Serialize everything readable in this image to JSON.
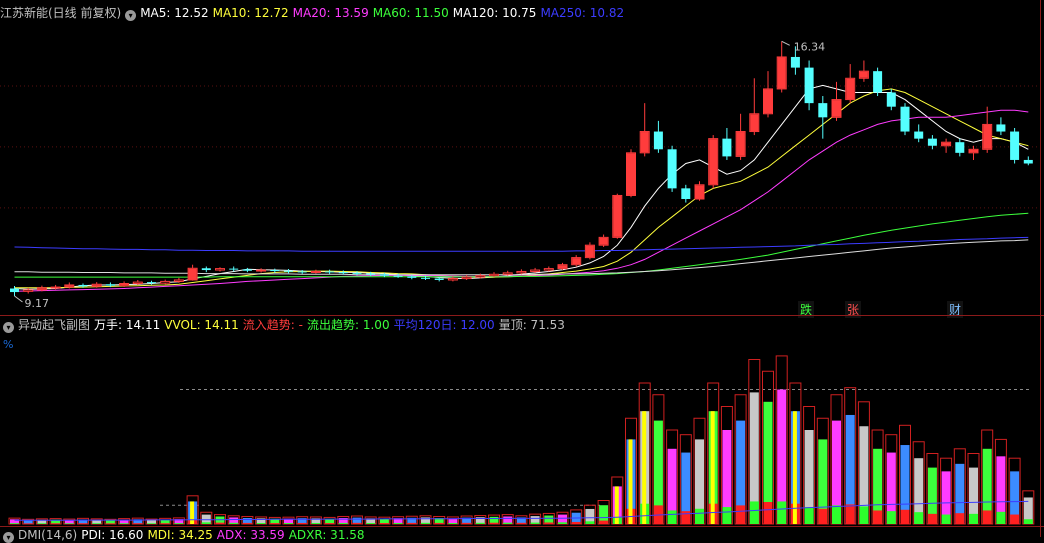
{
  "main_chart": {
    "title": "江苏新能(日线 前复权)",
    "ma": [
      {
        "label": "MA5: 12.52",
        "color": "#ffffff"
      },
      {
        "label": "MA10: 12.72",
        "color": "#ffff3c"
      },
      {
        "label": "MA20: 13.59",
        "color": "#ff3cff"
      },
      {
        "label": "MA60: 11.50",
        "color": "#3cff3c"
      },
      {
        "label": "MA120: 10.75",
        "color": "#ffffff"
      },
      {
        "label": "MA250: 10.82",
        "color": "#3c3cff"
      }
    ],
    "high_label": "16.34",
    "low_label": "9.17",
    "badges": [
      {
        "text": "跌",
        "color": "#3cff3c"
      },
      {
        "text": "张",
        "color": "#ff5050"
      },
      {
        "text": "财",
        "color": "#7fbfff"
      }
    ]
  },
  "indicator": {
    "title": "异动起飞副图",
    "items": [
      {
        "label": "万手: 14.11",
        "color": "#ffffff"
      },
      {
        "label": "VVOL: 14.11",
        "color": "#ffff3c"
      },
      {
        "label": "流入趋势: -",
        "color": "#ff3c3c"
      },
      {
        "label": "流出趋势: 1.00",
        "color": "#3cff3c"
      },
      {
        "label": "平均120日: 12.00",
        "color": "#3c3cff"
      },
      {
        "label": "量顶: 71.53",
        "color": "#c0c0c0"
      }
    ],
    "percent_label": "%"
  },
  "dmi": {
    "title": "DMI(14,6)",
    "items": [
      {
        "label": "PDI: 16.60",
        "color": "#ffffff"
      },
      {
        "label": "MDI: 34.25",
        "color": "#ffff3c"
      },
      {
        "label": "ADX: 33.59",
        "color": "#ff3cff"
      },
      {
        "label": "ADXR: 31.58",
        "color": "#3cff3c"
      }
    ]
  },
  "chart_data": {
    "type": "candlestick",
    "ylim": [
      9.0,
      16.8
    ],
    "candles": [
      [
        9.38,
        9.28,
        9.45,
        9.17
      ],
      [
        9.3,
        9.34,
        9.4,
        9.24
      ],
      [
        9.34,
        9.4,
        9.46,
        9.3
      ],
      [
        9.4,
        9.42,
        9.48,
        9.35
      ],
      [
        9.42,
        9.48,
        9.55,
        9.38
      ],
      [
        9.48,
        9.44,
        9.52,
        9.4
      ],
      [
        9.44,
        9.5,
        9.56,
        9.4
      ],
      [
        9.5,
        9.46,
        9.55,
        9.42
      ],
      [
        9.46,
        9.52,
        9.58,
        9.42
      ],
      [
        9.52,
        9.56,
        9.62,
        9.48
      ],
      [
        9.56,
        9.53,
        9.6,
        9.49
      ],
      [
        9.53,
        9.58,
        9.63,
        9.5
      ],
      [
        9.58,
        9.62,
        9.68,
        9.54
      ],
      [
        9.62,
        9.95,
        10.05,
        9.6
      ],
      [
        9.95,
        9.9,
        10.0,
        9.84
      ],
      [
        9.9,
        9.94,
        9.98,
        9.86
      ],
      [
        9.94,
        9.92,
        10.0,
        9.86
      ],
      [
        9.92,
        9.88,
        9.96,
        9.84
      ],
      [
        9.88,
        9.9,
        9.95,
        9.83
      ],
      [
        9.9,
        9.88,
        9.94,
        9.82
      ],
      [
        9.88,
        9.86,
        9.93,
        9.81
      ],
      [
        9.86,
        9.84,
        9.9,
        9.79
      ],
      [
        9.84,
        9.86,
        9.91,
        9.8
      ],
      [
        9.86,
        9.84,
        9.91,
        9.79
      ],
      [
        9.84,
        9.82,
        9.89,
        9.77
      ],
      [
        9.82,
        9.8,
        9.87,
        9.75
      ],
      [
        9.8,
        9.78,
        9.85,
        9.73
      ],
      [
        9.78,
        9.74,
        9.82,
        9.7
      ],
      [
        9.74,
        9.72,
        9.8,
        9.68
      ],
      [
        9.72,
        9.68,
        9.76,
        9.64
      ],
      [
        9.68,
        9.66,
        9.74,
        9.62
      ],
      [
        9.66,
        9.62,
        9.7,
        9.58
      ],
      [
        9.62,
        9.66,
        9.72,
        9.58
      ],
      [
        9.66,
        9.7,
        9.76,
        9.62
      ],
      [
        9.7,
        9.74,
        9.8,
        9.66
      ],
      [
        9.74,
        9.78,
        9.84,
        9.7
      ],
      [
        9.78,
        9.82,
        9.88,
        9.74
      ],
      [
        9.82,
        9.86,
        9.92,
        9.78
      ],
      [
        9.86,
        9.9,
        9.96,
        9.82
      ],
      [
        9.9,
        9.94,
        10.0,
        9.86
      ],
      [
        9.94,
        10.05,
        10.1,
        9.9
      ],
      [
        10.05,
        10.25,
        10.32,
        10.0
      ],
      [
        10.25,
        10.6,
        10.68,
        10.2
      ],
      [
        10.6,
        10.82,
        10.9,
        10.55
      ],
      [
        10.82,
        12.0,
        12.05,
        10.78
      ],
      [
        12.0,
        13.2,
        13.3,
        11.95
      ],
      [
        13.2,
        13.8,
        14.6,
        13.1
      ],
      [
        13.8,
        13.3,
        14.1,
        13.2
      ],
      [
        13.3,
        12.2,
        13.4,
        12.1
      ],
      [
        12.2,
        11.9,
        12.3,
        11.8
      ],
      [
        11.9,
        12.3,
        12.4,
        11.85
      ],
      [
        12.3,
        13.6,
        13.7,
        12.2
      ],
      [
        13.6,
        13.1,
        13.9,
        13.0
      ],
      [
        13.1,
        13.8,
        14.3,
        13.0
      ],
      [
        13.8,
        14.3,
        15.3,
        13.7
      ],
      [
        14.3,
        15.0,
        15.5,
        14.2
      ],
      [
        15.0,
        15.9,
        16.34,
        14.9
      ],
      [
        15.9,
        15.6,
        16.2,
        15.4
      ],
      [
        15.6,
        14.6,
        15.8,
        14.4
      ],
      [
        14.6,
        14.2,
        14.8,
        13.6
      ],
      [
        14.2,
        14.7,
        15.2,
        14.1
      ],
      [
        14.7,
        15.3,
        15.7,
        14.6
      ],
      [
        15.3,
        15.5,
        15.8,
        15.2
      ],
      [
        15.5,
        14.9,
        15.6,
        14.8
      ],
      [
        14.9,
        14.5,
        15.0,
        14.4
      ],
      [
        14.5,
        13.8,
        14.6,
        13.7
      ],
      [
        13.8,
        13.6,
        14.0,
        13.5
      ],
      [
        13.6,
        13.4,
        13.7,
        13.3
      ],
      [
        13.4,
        13.5,
        13.6,
        13.2
      ],
      [
        13.5,
        13.2,
        13.6,
        13.1
      ],
      [
        13.2,
        13.3,
        13.4,
        13.0
      ],
      [
        13.3,
        14.0,
        14.5,
        13.2
      ],
      [
        14.0,
        13.8,
        14.2,
        13.7
      ],
      [
        13.8,
        13.0,
        13.9,
        12.9
      ],
      [
        13.0,
        12.9,
        13.1,
        12.85
      ]
    ],
    "ma_series": [
      {
        "name": "MA5",
        "color": "#ffffff",
        "values": [
          9.38,
          9.36,
          9.37,
          9.38,
          9.42,
          9.46,
          9.48,
          9.48,
          9.49,
          9.5,
          9.52,
          9.55,
          9.57,
          9.65,
          9.72,
          9.8,
          9.86,
          9.92,
          9.91,
          9.9,
          9.89,
          9.87,
          9.86,
          9.85,
          9.84,
          9.83,
          9.81,
          9.8,
          9.77,
          9.74,
          9.72,
          9.69,
          9.67,
          9.66,
          9.68,
          9.7,
          9.74,
          9.78,
          9.82,
          9.86,
          9.91,
          9.98,
          10.1,
          10.28,
          10.6,
          11.1,
          11.7,
          12.2,
          12.6,
          12.9,
          13.0,
          12.8,
          12.6,
          12.7,
          13.0,
          13.5,
          14.0,
          14.5,
          15.0,
          15.1,
          15.0,
          14.9,
          14.9,
          14.9,
          14.9,
          14.7,
          14.4,
          14.1,
          13.8,
          13.6,
          13.5,
          13.6,
          13.6,
          13.5,
          13.3
        ]
      },
      {
        "name": "MA10",
        "color": "#ffff3c",
        "values": [
          9.4,
          9.4,
          9.4,
          9.4,
          9.41,
          9.42,
          9.43,
          9.44,
          9.45,
          9.46,
          9.47,
          9.48,
          9.5,
          9.55,
          9.6,
          9.65,
          9.7,
          9.75,
          9.8,
          9.83,
          9.85,
          9.86,
          9.87,
          9.87,
          9.86,
          9.85,
          9.83,
          9.82,
          9.8,
          9.79,
          9.77,
          9.75,
          9.73,
          9.71,
          9.7,
          9.7,
          9.71,
          9.73,
          9.76,
          9.79,
          9.83,
          9.87,
          9.93,
          10.0,
          10.15,
          10.4,
          10.75,
          11.1,
          11.4,
          11.7,
          12.0,
          12.2,
          12.3,
          12.4,
          12.6,
          12.8,
          13.1,
          13.4,
          13.7,
          14.0,
          14.3,
          14.6,
          14.8,
          14.95,
          15.0,
          14.9,
          14.7,
          14.5,
          14.3,
          14.1,
          13.9,
          13.7,
          13.6,
          13.5,
          13.4
        ]
      },
      {
        "name": "MA20",
        "color": "#ff3cff",
        "values": [
          9.3,
          9.31,
          9.32,
          9.33,
          9.34,
          9.35,
          9.36,
          9.37,
          9.38,
          9.4,
          9.42,
          9.44,
          9.46,
          9.48,
          9.5,
          9.52,
          9.55,
          9.58,
          9.6,
          9.62,
          9.64,
          9.66,
          9.68,
          9.7,
          9.72,
          9.73,
          9.74,
          9.75,
          9.75,
          9.75,
          9.75,
          9.74,
          9.73,
          9.72,
          9.72,
          9.72,
          9.72,
          9.73,
          9.74,
          9.76,
          9.78,
          9.81,
          9.84,
          9.88,
          9.95,
          10.05,
          10.2,
          10.4,
          10.6,
          10.8,
          11.0,
          11.2,
          11.4,
          11.6,
          11.85,
          12.1,
          12.4,
          12.7,
          13.0,
          13.25,
          13.5,
          13.7,
          13.85,
          14.0,
          14.1,
          14.15,
          14.2,
          14.2,
          14.2,
          14.25,
          14.3,
          14.35,
          14.4,
          14.4,
          14.35
        ]
      },
      {
        "name": "MA60",
        "color": "#3cff3c",
        "values": [
          9.7,
          9.7,
          9.7,
          9.7,
          9.7,
          9.7,
          9.7,
          9.7,
          9.7,
          9.7,
          9.7,
          9.7,
          9.7,
          9.7,
          9.7,
          9.71,
          9.71,
          9.71,
          9.71,
          9.71,
          9.71,
          9.71,
          9.71,
          9.71,
          9.71,
          9.71,
          9.71,
          9.71,
          9.71,
          9.71,
          9.71,
          9.71,
          9.71,
          9.71,
          9.71,
          9.71,
          9.71,
          9.72,
          9.72,
          9.73,
          9.74,
          9.75,
          9.76,
          9.78,
          9.8,
          9.83,
          9.86,
          9.9,
          9.95,
          10.0,
          10.05,
          10.1,
          10.15,
          10.2,
          10.26,
          10.32,
          10.4,
          10.48,
          10.56,
          10.64,
          10.72,
          10.8,
          10.88,
          10.95,
          11.02,
          11.08,
          11.14,
          11.2,
          11.25,
          11.3,
          11.35,
          11.4,
          11.44,
          11.47,
          11.5
        ]
      },
      {
        "name": "MA120",
        "color": "#dddddd",
        "values": [
          9.85,
          9.85,
          9.84,
          9.84,
          9.84,
          9.83,
          9.83,
          9.83,
          9.82,
          9.82,
          9.82,
          9.81,
          9.81,
          9.81,
          9.8,
          9.8,
          9.8,
          9.79,
          9.79,
          9.79,
          9.79,
          9.78,
          9.78,
          9.78,
          9.78,
          9.77,
          9.77,
          9.77,
          9.77,
          9.77,
          9.77,
          9.77,
          9.77,
          9.77,
          9.77,
          9.77,
          9.77,
          9.77,
          9.78,
          9.78,
          9.79,
          9.79,
          9.8,
          9.81,
          9.82,
          9.84,
          9.86,
          9.88,
          9.91,
          9.94,
          9.97,
          10.0,
          10.04,
          10.08,
          10.12,
          10.16,
          10.2,
          10.24,
          10.28,
          10.32,
          10.36,
          10.4,
          10.44,
          10.48,
          10.52,
          10.55,
          10.58,
          10.61,
          10.64,
          10.66,
          10.68,
          10.7,
          10.72,
          10.73,
          10.75
        ]
      },
      {
        "name": "MA250",
        "color": "#3c3cff",
        "values": [
          10.55,
          10.54,
          10.53,
          10.52,
          10.51,
          10.5,
          10.5,
          10.49,
          10.48,
          10.48,
          10.47,
          10.47,
          10.46,
          10.46,
          10.45,
          10.45,
          10.45,
          10.44,
          10.44,
          10.44,
          10.44,
          10.43,
          10.43,
          10.43,
          10.43,
          10.43,
          10.43,
          10.43,
          10.43,
          10.43,
          10.43,
          10.43,
          10.43,
          10.43,
          10.43,
          10.43,
          10.43,
          10.43,
          10.43,
          10.43,
          10.43,
          10.44,
          10.44,
          10.45,
          10.45,
          10.46,
          10.47,
          10.48,
          10.49,
          10.5,
          10.51,
          10.52,
          10.53,
          10.54,
          10.55,
          10.56,
          10.57,
          10.58,
          10.6,
          10.61,
          10.62,
          10.64,
          10.65,
          10.67,
          10.68,
          10.7,
          10.71,
          10.73,
          10.74,
          10.76,
          10.77,
          10.78,
          10.8,
          10.81,
          10.82
        ]
      }
    ],
    "indicator_ylim": [
      0,
      100
    ],
    "volume": [
      2.5,
      2.0,
      2.2,
      2.3,
      2.1,
      2.4,
      2.2,
      2.0,
      2.3,
      2.5,
      2.1,
      2.4,
      2.6,
      12.0,
      5.0,
      4.0,
      3.5,
      3.2,
      3.0,
      2.8,
      2.9,
      3.1,
      3.0,
      2.8,
      3.2,
      3.4,
      3.0,
      2.9,
      3.1,
      3.3,
      3.5,
      3.2,
      3.0,
      3.4,
      3.6,
      3.8,
      4.0,
      3.5,
      4.2,
      4.5,
      5.0,
      6.0,
      8.0,
      10.0,
      20.0,
      45.0,
      60.0,
      55.0,
      40.0,
      38.0,
      45.0,
      60.0,
      50.0,
      55.0,
      70.0,
      65.0,
      71.53,
      60.0,
      50.0,
      45.0,
      55.0,
      58.0,
      52.0,
      40.0,
      38.0,
      42.0,
      35.0,
      30.0,
      28.0,
      32.0,
      30.0,
      40.0,
      36.0,
      28.0,
      14.11
    ],
    "vvol_markers": [
      13,
      44,
      45,
      46,
      51,
      57
    ],
    "avg120": [
      2.0,
      2.0,
      2.0,
      2.0,
      2.0,
      2.1,
      2.1,
      2.1,
      2.1,
      2.1,
      2.2,
      2.2,
      2.2,
      2.3,
      2.3,
      2.3,
      2.4,
      2.4,
      2.4,
      2.5,
      2.5,
      2.5,
      2.5,
      2.6,
      2.6,
      2.6,
      2.6,
      2.7,
      2.7,
      2.7,
      2.8,
      2.8,
      2.8,
      2.9,
      2.9,
      2.9,
      3.0,
      3.0,
      3.0,
      3.1,
      3.1,
      3.2,
      3.3,
      3.4,
      3.6,
      4.0,
      4.4,
      4.8,
      5.1,
      5.4,
      5.7,
      6.1,
      6.4,
      6.8,
      7.2,
      7.6,
      8.0,
      8.4,
      8.7,
      9.0,
      9.3,
      9.6,
      9.9,
      10.2,
      10.4,
      10.6,
      10.8,
      11.0,
      11.2,
      11.4,
      11.5,
      11.7,
      11.8,
      11.9,
      12.0
    ]
  }
}
